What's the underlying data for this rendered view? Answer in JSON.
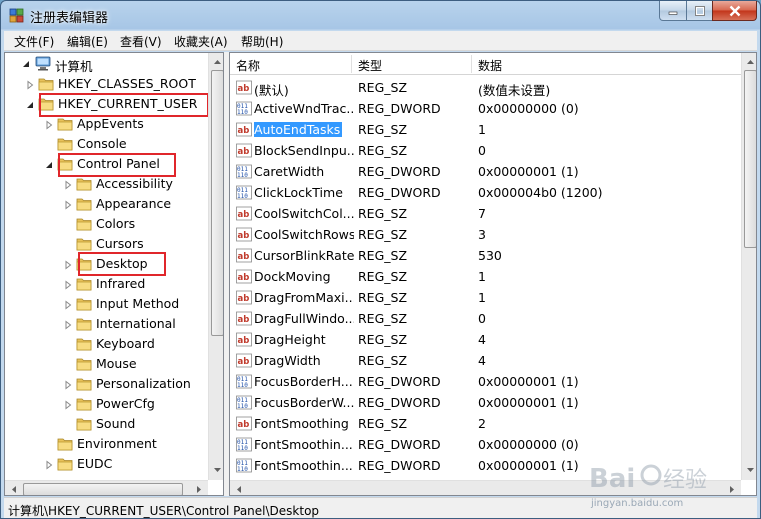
{
  "window": {
    "title": "注册表编辑器"
  },
  "menu": [
    {
      "label": "文件(F)"
    },
    {
      "label": "编辑(E)"
    },
    {
      "label": "查看(V)"
    },
    {
      "label": "收藏夹(A)"
    },
    {
      "label": "帮助(H)"
    }
  ],
  "tree": {
    "root": "计算机",
    "items": [
      {
        "label": "HKEY_CLASSES_ROOT",
        "level": 1,
        "expanded": false
      },
      {
        "label": "HKEY_CURRENT_USER",
        "level": 1,
        "expanded": true,
        "highlighted": true
      },
      {
        "label": "AppEvents",
        "level": 2,
        "expanded": false
      },
      {
        "label": "Console",
        "level": 2,
        "expanded": null
      },
      {
        "label": "Control Panel",
        "level": 2,
        "expanded": true,
        "highlighted": true
      },
      {
        "label": "Accessibility",
        "level": 3,
        "expanded": false
      },
      {
        "label": "Appearance",
        "level": 3,
        "expanded": false
      },
      {
        "label": "Colors",
        "level": 3,
        "expanded": null
      },
      {
        "label": "Cursors",
        "level": 3,
        "expanded": null
      },
      {
        "label": "Desktop",
        "level": 3,
        "expanded": false,
        "highlighted": true,
        "selected": true
      },
      {
        "label": "Infrared",
        "level": 3,
        "expanded": false
      },
      {
        "label": "Input Method",
        "level": 3,
        "expanded": false
      },
      {
        "label": "International",
        "level": 3,
        "expanded": false
      },
      {
        "label": "Keyboard",
        "level": 3,
        "expanded": null
      },
      {
        "label": "Mouse",
        "level": 3,
        "expanded": null
      },
      {
        "label": "Personalization",
        "level": 3,
        "expanded": false
      },
      {
        "label": "PowerCfg",
        "level": 3,
        "expanded": false
      },
      {
        "label": "Sound",
        "level": 3,
        "expanded": null
      },
      {
        "label": "Environment",
        "level": 2,
        "expanded": null
      },
      {
        "label": "EUDC",
        "level": 2,
        "expanded": false
      }
    ]
  },
  "list": {
    "columns": [
      "名称",
      "类型",
      "数据"
    ],
    "rows": [
      {
        "icon": "ab",
        "name": "(默认)",
        "type": "REG_SZ",
        "data": "(数值未设置)"
      },
      {
        "icon": "bin",
        "name": "ActiveWndTrac...",
        "type": "REG_DWORD",
        "data": "0x00000000 (0)"
      },
      {
        "icon": "ab",
        "name": "AutoEndTasks",
        "type": "REG_SZ",
        "data": "1",
        "selected": true
      },
      {
        "icon": "ab",
        "name": "BlockSendInpu...",
        "type": "REG_SZ",
        "data": "0"
      },
      {
        "icon": "bin",
        "name": "CaretWidth",
        "type": "REG_DWORD",
        "data": "0x00000001 (1)"
      },
      {
        "icon": "bin",
        "name": "ClickLockTime",
        "type": "REG_DWORD",
        "data": "0x000004b0 (1200)"
      },
      {
        "icon": "ab",
        "name": "CoolSwitchCol...",
        "type": "REG_SZ",
        "data": "7"
      },
      {
        "icon": "ab",
        "name": "CoolSwitchRows",
        "type": "REG_SZ",
        "data": "3"
      },
      {
        "icon": "ab",
        "name": "CursorBlinkRate",
        "type": "REG_SZ",
        "data": "530"
      },
      {
        "icon": "ab",
        "name": "DockMoving",
        "type": "REG_SZ",
        "data": "1"
      },
      {
        "icon": "ab",
        "name": "DragFromMaxi...",
        "type": "REG_SZ",
        "data": "1"
      },
      {
        "icon": "ab",
        "name": "DragFullWindo...",
        "type": "REG_SZ",
        "data": "0"
      },
      {
        "icon": "ab",
        "name": "DragHeight",
        "type": "REG_SZ",
        "data": "4"
      },
      {
        "icon": "ab",
        "name": "DragWidth",
        "type": "REG_SZ",
        "data": "4"
      },
      {
        "icon": "bin",
        "name": "FocusBorderH...",
        "type": "REG_DWORD",
        "data": "0x00000001 (1)"
      },
      {
        "icon": "bin",
        "name": "FocusBorderW...",
        "type": "REG_DWORD",
        "data": "0x00000001 (1)"
      },
      {
        "icon": "ab",
        "name": "FontSmoothing",
        "type": "REG_SZ",
        "data": "2"
      },
      {
        "icon": "bin",
        "name": "FontSmoothin...",
        "type": "REG_DWORD",
        "data": "0x00000000 (0)"
      },
      {
        "icon": "bin",
        "name": "FontSmoothin...",
        "type": "REG_DWORD",
        "data": "0x00000001 (1)"
      }
    ]
  },
  "status": {
    "path": "计算机\\HKEY_CURRENT_USER\\Control Panel\\Desktop"
  },
  "watermark": {
    "text": "jingyan.baidu.com"
  },
  "colors": {
    "highlight_box": "#e0262b",
    "selection": "#3399ff"
  }
}
